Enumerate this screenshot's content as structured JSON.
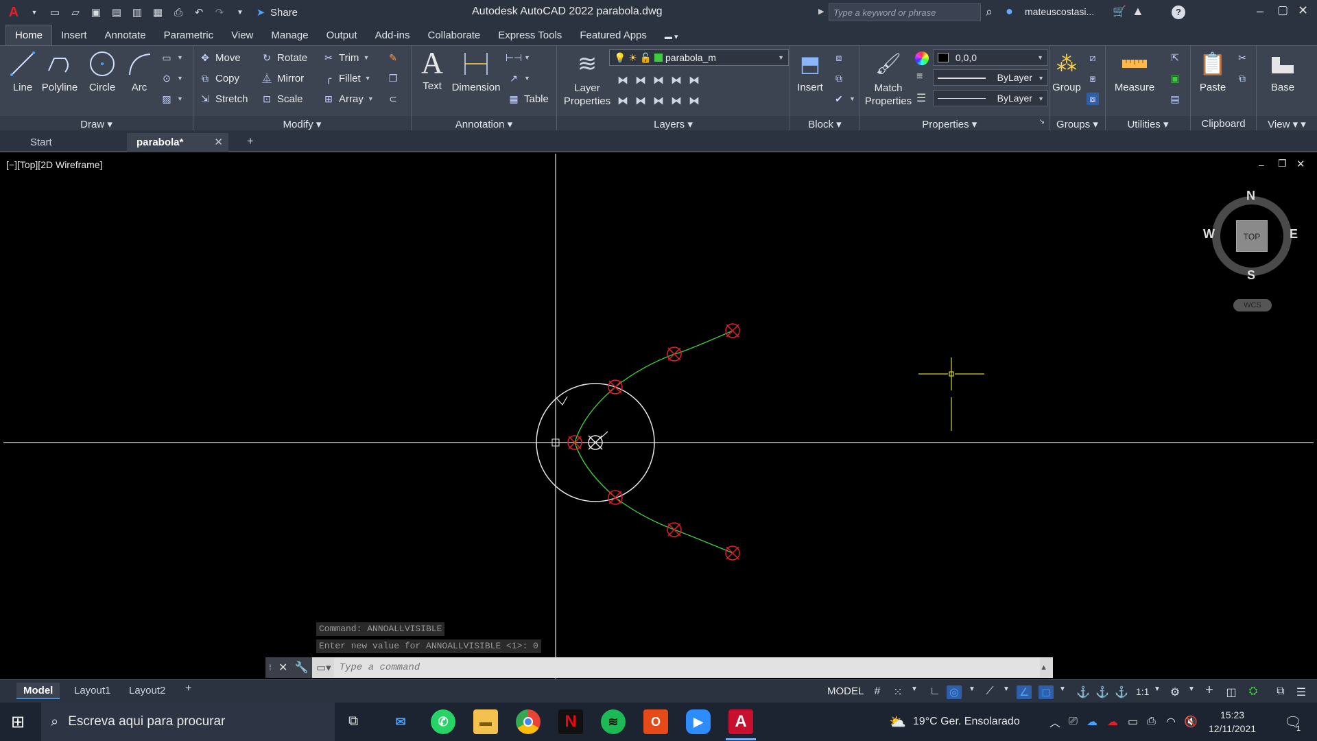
{
  "titlebar": {
    "app_title": "Autodesk AutoCAD 2022   parabola.dwg",
    "share_label": "Share",
    "search_placeholder": "Type a keyword or phrase",
    "user_name": "mateuscostasi..."
  },
  "ribbon_tabs": [
    "Home",
    "Insert",
    "Annotate",
    "Parametric",
    "View",
    "Manage",
    "Output",
    "Add-ins",
    "Collaborate",
    "Express Tools",
    "Featured Apps"
  ],
  "ribbon": {
    "draw": {
      "title": "Draw",
      "line": "Line",
      "polyline": "Polyline",
      "circle": "Circle",
      "arc": "Arc"
    },
    "modify": {
      "title": "Modify",
      "move": "Move",
      "rotate": "Rotate",
      "trim": "Trim",
      "copy": "Copy",
      "mirror": "Mirror",
      "fillet": "Fillet",
      "stretch": "Stretch",
      "scale": "Scale",
      "array": "Array"
    },
    "annotation": {
      "title": "Annotation",
      "text": "Text",
      "dimension": "Dimension",
      "table": "Table"
    },
    "layers": {
      "title": "Layers",
      "layer_properties": "Layer Properties",
      "current_layer": "parabola_m"
    },
    "block": {
      "title": "Block",
      "insert": "Insert"
    },
    "properties": {
      "title": "Properties",
      "match": "Match Properties",
      "color": "0,0,0",
      "linetype": "ByLayer",
      "lineweight": "ByLayer"
    },
    "groups": {
      "title": "Groups",
      "group": "Group"
    },
    "utilities": {
      "title": "Utilities",
      "measure": "Measure"
    },
    "clipboard": {
      "title": "Clipboard",
      "paste": "Paste"
    },
    "view": {
      "title": "View",
      "base": "Base"
    }
  },
  "doc_tabs": {
    "start": "Start",
    "active": "parabola*"
  },
  "viewport": {
    "label": "[−][Top][2D Wireframe]",
    "compass": {
      "n": "N",
      "s": "S",
      "e": "E",
      "w": "W",
      "top": "TOP",
      "ucs": "WCS"
    }
  },
  "command": {
    "history": [
      "Command: ANNOALLVISIBLE",
      "Enter new value for ANNOALLVISIBLE <1>: 0"
    ],
    "placeholder": "Type a command"
  },
  "status": {
    "layout_tabs": [
      "Model",
      "Layout1",
      "Layout2"
    ],
    "model_label": "MODEL",
    "scale": "1:1"
  },
  "taskbar": {
    "search_placeholder": "Escreva aqui para procurar",
    "weather": "19°C  Ger. Ensolarado",
    "time": "15:23",
    "date": "12/11/2021",
    "notif_count": "1"
  },
  "colors": {
    "accent": "#4aa3ff",
    "drawing_green": "#3ecb3e",
    "marker_red": "#e0202a",
    "cursor_yellow": "#d7d72a"
  }
}
